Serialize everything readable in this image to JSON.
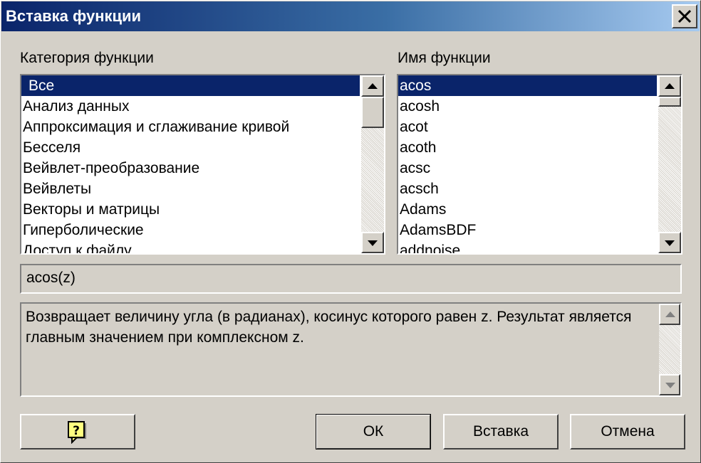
{
  "window": {
    "title": "Вставка функции",
    "close_icon": "close-icon"
  },
  "category": {
    "label": "Категория функции",
    "items": [
      "Все",
      "Анализ данных",
      "Аппроксимация и сглаживание кривой",
      "Бесселя",
      "Вейвлет-преобразование",
      "Вейвлеты",
      "Векторы и матрицы",
      "Гиперболические",
      "Доступ к файлу"
    ],
    "selected_index": 0
  },
  "function_name": {
    "label": "Имя функции",
    "items": [
      "acos",
      "acosh",
      "acot",
      "acoth",
      "acsc",
      "acsch",
      "Adams",
      "AdamsBDF",
      "addnoise"
    ],
    "selected_index": 0
  },
  "signature": "acos(z)",
  "description": "Возвращает величину угла (в радианах), косинус которого равен z. Результат является главным значением при комплексном z.",
  "buttons": {
    "help_icon": "help-icon",
    "ok": "ОК",
    "insert": "Вставка",
    "cancel": "Отмена"
  },
  "colors": {
    "selection": "#0a246a",
    "face": "#d4d0c8",
    "titlebar_start": "#0a246a",
    "titlebar_end": "#a6caf0"
  }
}
